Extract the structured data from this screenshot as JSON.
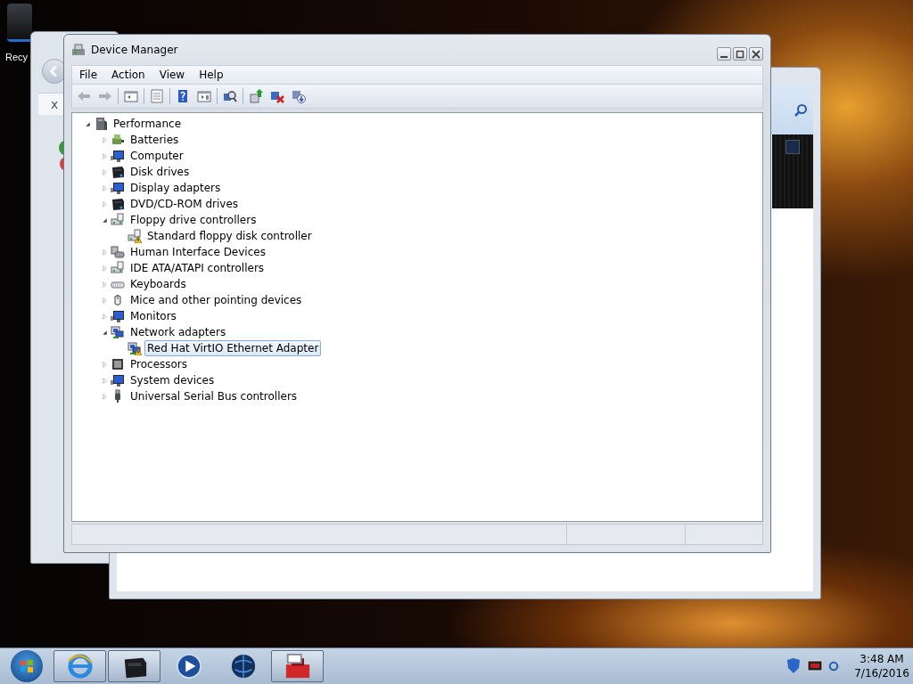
{
  "desktop": {
    "icon_label": "Recy"
  },
  "back_window_left": {
    "close_tab": "x"
  },
  "main_window": {
    "title": "Device Manager",
    "menu": [
      {
        "label": "File"
      },
      {
        "label": "Action"
      },
      {
        "label": "View"
      },
      {
        "label": "Help"
      }
    ],
    "toolbar": [
      {
        "kind": "back",
        "disabled": true
      },
      {
        "kind": "forward",
        "disabled": true
      },
      {
        "kind": "separator"
      },
      {
        "kind": "tree",
        "disabled": false
      },
      {
        "kind": "separator"
      },
      {
        "kind": "properties",
        "disabled": false
      },
      {
        "kind": "separator"
      },
      {
        "kind": "help",
        "disabled": false
      },
      {
        "kind": "pane",
        "disabled": false
      },
      {
        "kind": "separator"
      },
      {
        "kind": "scan",
        "disabled": false
      },
      {
        "kind": "separator"
      },
      {
        "kind": "update",
        "disabled": false
      },
      {
        "kind": "uninstall",
        "disabled": false
      },
      {
        "kind": "disable",
        "disabled": false
      }
    ],
    "tree": {
      "label": "Performance",
      "kind": "computer",
      "expanded": true,
      "selected": false,
      "children": [
        {
          "label": "Batteries",
          "kind": "battery",
          "expanded": false,
          "selected": false
        },
        {
          "label": "Computer",
          "kind": "monitor",
          "expanded": false,
          "selected": false
        },
        {
          "label": "Disk drives",
          "kind": "disk",
          "expanded": false,
          "selected": false
        },
        {
          "label": "Display adapters",
          "kind": "monitor",
          "expanded": false,
          "selected": false
        },
        {
          "label": "DVD/CD-ROM drives",
          "kind": "disk",
          "expanded": false,
          "selected": false
        },
        {
          "label": "Floppy drive controllers",
          "kind": "controller",
          "expanded": true,
          "selected": false,
          "children": [
            {
              "label": "Standard floppy disk controller",
              "kind": "controller",
              "warning": true,
              "selected": false
            }
          ]
        },
        {
          "label": "Human Interface Devices",
          "kind": "hid",
          "expanded": false,
          "selected": false
        },
        {
          "label": "IDE ATA/ATAPI controllers",
          "kind": "controller",
          "expanded": false,
          "selected": false
        },
        {
          "label": "Keyboards",
          "kind": "keyboard",
          "expanded": false,
          "selected": false
        },
        {
          "label": "Mice and other pointing devices",
          "kind": "mouse",
          "expanded": false,
          "selected": false
        },
        {
          "label": "Monitors",
          "kind": "monitor",
          "expanded": false,
          "selected": false
        },
        {
          "label": "Network adapters",
          "kind": "network",
          "expanded": true,
          "selected": false,
          "children": [
            {
              "label": "Red Hat VirtIO Ethernet Adapter",
              "kind": "network",
              "warning": true,
              "selected": true
            }
          ]
        },
        {
          "label": "Processors",
          "kind": "chip",
          "expanded": false,
          "selected": false
        },
        {
          "label": "System devices",
          "kind": "monitor",
          "expanded": false,
          "selected": false
        },
        {
          "label": "Universal Serial Bus controllers",
          "kind": "usb",
          "expanded": false,
          "selected": false
        }
      ]
    }
  },
  "taskbar": {
    "buttons": [
      {
        "kind": "browser",
        "running": true
      },
      {
        "kind": "device",
        "running": true
      },
      {
        "kind": "media",
        "running": false
      },
      {
        "kind": "globe",
        "running": false
      },
      {
        "kind": "toolbox",
        "running": true
      }
    ],
    "clock": {
      "time": "3:48 AM",
      "date": "7/16/2016"
    }
  }
}
